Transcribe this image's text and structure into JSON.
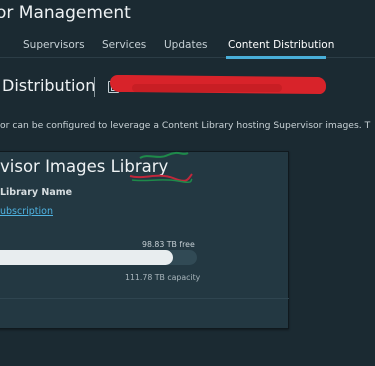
{
  "header": {
    "title": "or Management"
  },
  "tabs": [
    {
      "label": "Supervisors"
    },
    {
      "label": "Services"
    },
    {
      "label": "Updates"
    },
    {
      "label": "Content Distribution",
      "active": true
    }
  ],
  "page": {
    "subtitle": "Distribution",
    "description": "or can be configured to leverage a Content Library hosting Supervisor images. T"
  },
  "card": {
    "title": "visor Images Library",
    "library_name_label": "Library Name",
    "library_link": "ubscription",
    "storage": {
      "free_text": "98.83 TB free",
      "capacity_text": "111.78 TB capacity",
      "used_fraction": 0.116
    }
  },
  "colors": {
    "background": "#1b2a32",
    "accent": "#49afd9",
    "link": "#4fb3e2",
    "redaction": "#d8232a"
  },
  "icons": {
    "library": "content-library-icon"
  }
}
